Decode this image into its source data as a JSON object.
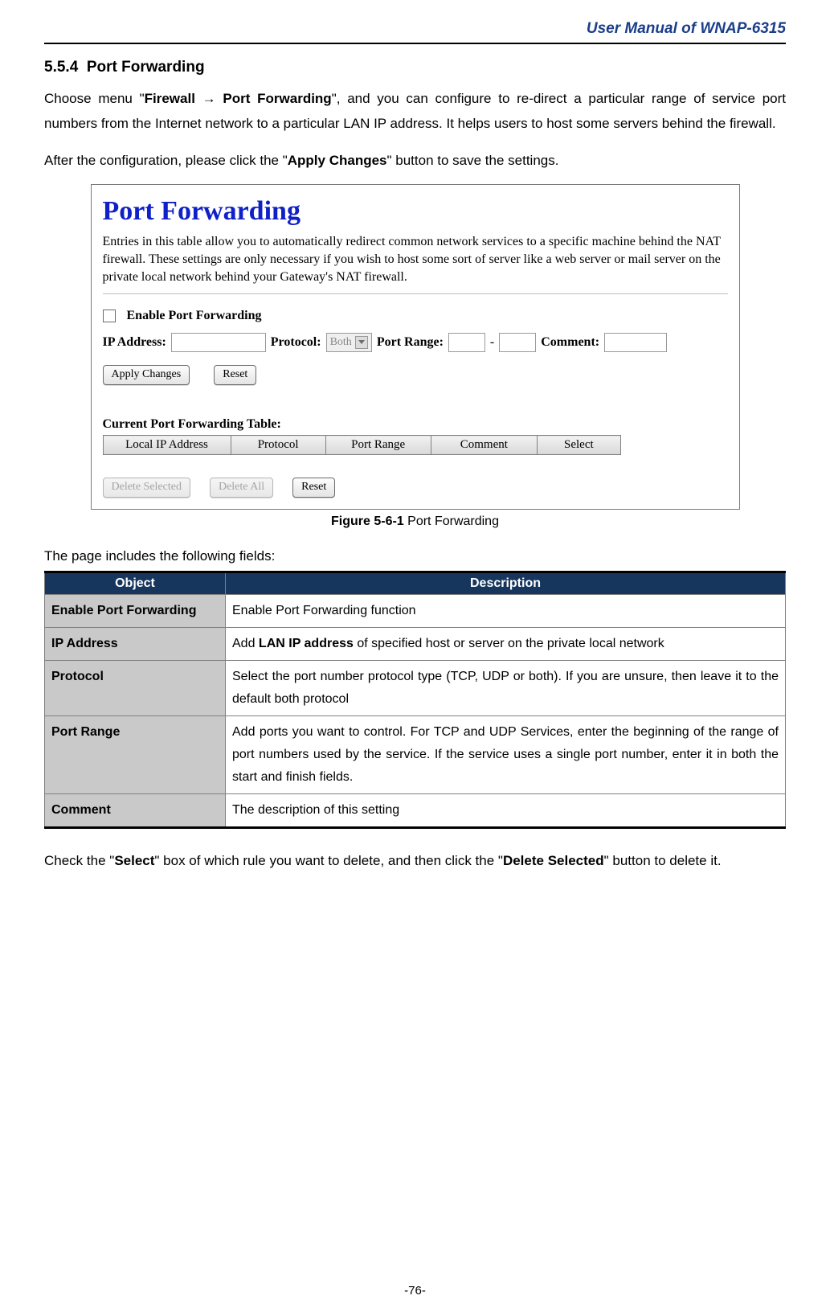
{
  "header": {
    "title": "User Manual of WNAP-6315"
  },
  "section": {
    "number": "5.5.4",
    "title": "Port Forwarding"
  },
  "paragraphs": {
    "p1_a": "Choose menu \"",
    "p1_b": "Firewall",
    "p1_arrow": " → ",
    "p1_c": "Port Forwarding",
    "p1_d": "\", and you can configure to re-direct a particular range of service port numbers from the Internet network to a particular LAN IP address. It helps users to host some servers behind the firewall.",
    "p2_a": "After the configuration, please click the \"",
    "p2_b": "Apply Changes",
    "p2_c": "\" button to save the settings.",
    "lead_in": "The page includes the following fields:",
    "p3_a": "Check the \"",
    "p3_b": "Select",
    "p3_c": "\" box of which rule you want to delete, and then click the \"",
    "p3_d": "Delete Selected",
    "p3_e": "\" button to delete it."
  },
  "screenshot": {
    "title": "Port Forwarding",
    "intro": "Entries in this table allow you to automatically redirect common network services to a specific machine behind the NAT firewall. These settings are only necessary if you wish to host some sort of server like a web server or mail server on the private local network behind your Gateway's NAT firewall.",
    "enable_label": "Enable Port Forwarding",
    "ip_label": "IP Address:",
    "protocol_label": "Protocol:",
    "protocol_value": "Both",
    "portrange_label": "Port Range:",
    "dash": "-",
    "comment_label": "Comment:",
    "btn_apply": "Apply Changes",
    "btn_reset": "Reset",
    "table_title": "Current Port Forwarding Table:",
    "th1": "Local IP Address",
    "th2": "Protocol",
    "th3": "Port Range",
    "th4": "Comment",
    "th5": "Select",
    "btn_del_sel": "Delete Selected",
    "btn_del_all": "Delete All",
    "btn_reset2": "Reset"
  },
  "figure": {
    "label": "Figure 5-6-1",
    "caption": " Port Forwarding"
  },
  "desc_table": {
    "head_obj": "Object",
    "head_desc": "Description",
    "rows": [
      {
        "obj": "Enable Port Forwarding",
        "desc_a": "Enable Port Forwarding function"
      },
      {
        "obj": "IP Address",
        "desc_a": "Add ",
        "desc_bold": "LAN IP address",
        "desc_b": " of specified host or server on the private local network"
      },
      {
        "obj": "Protocol",
        "desc_a": "Select the port number protocol type (TCP, UDP or both). If you are unsure, then leave it to the default both protocol"
      },
      {
        "obj": "Port Range",
        "desc_a": "Add ports you want to control. For TCP and UDP Services, enter the beginning of the range of port numbers used by the service. If the service uses a single port number, enter it in both the start and finish fields."
      },
      {
        "obj": "Comment",
        "desc_a": "The description of this setting"
      }
    ]
  },
  "footer": {
    "page": "-76-"
  }
}
